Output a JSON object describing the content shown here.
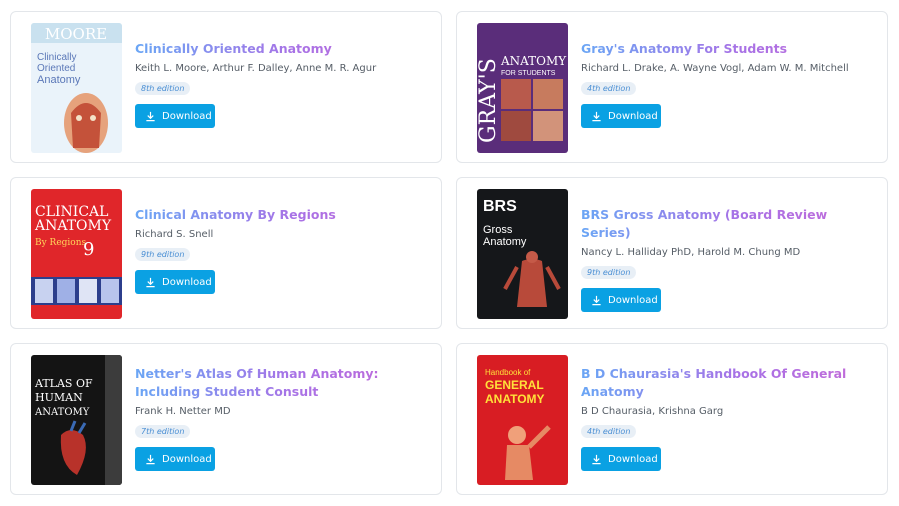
{
  "books": [
    {
      "title": "Clinically Oriented Anatomy",
      "authors": "Keith L. Moore, Arthur F. Dalley, Anne M. R. Agur",
      "edition": "8th edition",
      "download_label": "Download",
      "cover": {
        "line1": "MOORE",
        "line2": "Clinically",
        "line3": "Oriented",
        "line4": "Anatomy",
        "bg": "#eaf3fa"
      }
    },
    {
      "title": "Gray's Anatomy For Students",
      "authors": "Richard L. Drake, A. Wayne Vogl, Adam W. M. Mitchell",
      "edition": "4th edition",
      "download_label": "Download",
      "cover": {
        "line1": "GRAY'S",
        "line2": "ANATOMY",
        "line3": "FOR STUDENTS",
        "line4": "",
        "bg": "#5a2d7a"
      }
    },
    {
      "title": "Clinical Anatomy By Regions",
      "authors": "Richard S. Snell",
      "edition": "9th edition",
      "download_label": "Download",
      "cover": {
        "line1": "CLINICAL",
        "line2": "ANATOMY",
        "line3": "By Regions",
        "line4": "9",
        "bg": "#e0262a"
      }
    },
    {
      "title": "BRS Gross Anatomy (Board Review Series)",
      "authors": "Nancy L. Halliday PhD, Harold M. Chung MD",
      "edition": "9th edition",
      "download_label": "Download",
      "cover": {
        "line1": "BRS",
        "line2": "Gross",
        "line3": "Anatomy",
        "line4": "",
        "bg": "#15171a"
      }
    },
    {
      "title": "Netter's Atlas Of Human Anatomy: Including Student Consult",
      "authors": "Frank H. Netter MD",
      "edition": "7th edition",
      "download_label": "Download",
      "cover": {
        "line1": "ATLAS OF",
        "line2": "HUMAN",
        "line3": "ANATOMY",
        "line4": "",
        "bg": "#141414"
      }
    },
    {
      "title": "B D Chaurasia's Handbook Of General Anatomy",
      "authors": "B D Chaurasia, Krishna Garg",
      "edition": "4th edition",
      "download_label": "Download",
      "cover": {
        "line1": "Handbook of",
        "line2": "GENERAL",
        "line3": "ANATOMY",
        "line4": "",
        "bg": "#d81d23"
      }
    }
  ],
  "colors": {
    "button": "#0aa1e3",
    "title_start": "#6aa6f5",
    "title_end": "#c46ad8",
    "edition_text": "#4a8fd4"
  }
}
